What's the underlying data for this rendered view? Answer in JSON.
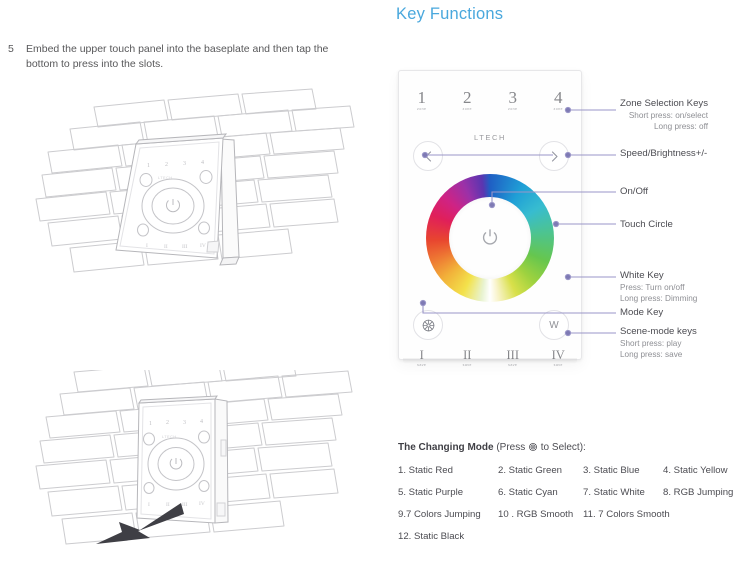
{
  "left": {
    "step_number": "5",
    "step_text": "Embed the upper touch panel into the baseplate and then tap the bottom to press into the slots."
  },
  "right": {
    "section_title": "Key Functions"
  },
  "device": {
    "brand": "LTECH",
    "zone_keys": [
      {
        "num": "1",
        "sub": "zone"
      },
      {
        "num": "2",
        "sub": "zone"
      },
      {
        "num": "3",
        "sub": "zone"
      },
      {
        "num": "4",
        "sub": "zone"
      }
    ],
    "scene_keys": [
      {
        "num": "I",
        "sub": "save"
      },
      {
        "num": "II",
        "sub": "save"
      },
      {
        "num": "III",
        "sub": "save"
      },
      {
        "num": "IV",
        "sub": "save"
      }
    ],
    "white_key_label": "W",
    "prev_icon": "chevron-left-icon",
    "next_icon": "chevron-right-icon",
    "power_icon": "power-icon",
    "mode_icon": "mode-wheel-icon"
  },
  "annotations": [
    {
      "title": "Zone Selection Keys",
      "lines": [
        "Short press: on/select",
        "Long press: off"
      ],
      "align": "right"
    },
    {
      "title": "Speed/Brightness+/-",
      "lines": []
    },
    {
      "title": "On/Off",
      "lines": []
    },
    {
      "title": "Touch Circle",
      "lines": []
    },
    {
      "title": "White Key",
      "lines": [
        "Press: Turn on/off",
        "Long press: Dimming"
      ],
      "align": "left"
    },
    {
      "title": "Mode Key",
      "lines": []
    },
    {
      "title": "Scene-mode keys",
      "lines": [
        "Short press: play",
        "Long press: save"
      ],
      "align": "center"
    }
  ],
  "changing_mode": {
    "heading_bold": "The Changing Mode",
    "heading_rest_pre": " (Press ",
    "heading_rest_post": " to Select):",
    "rows": [
      [
        "1. Static Red",
        "2. Static Green",
        "3. Static Blue",
        "4. Static Yellow"
      ],
      [
        "5. Static Purple",
        "6. Static Cyan",
        "7. Static White",
        "8. RGB Jumping"
      ],
      [
        "9.7 Colors Jumping",
        "10 . RGB Smooth",
        "11. 7 Colors Smooth"
      ],
      [
        "12. Static Black"
      ]
    ]
  },
  "colors": {
    "accent_title": "#4aa8dd",
    "lead_line": "#9a96c8",
    "body_text": "#4c4c52",
    "muted_text": "#8e8f94",
    "line_art": "#c9c9cc"
  }
}
